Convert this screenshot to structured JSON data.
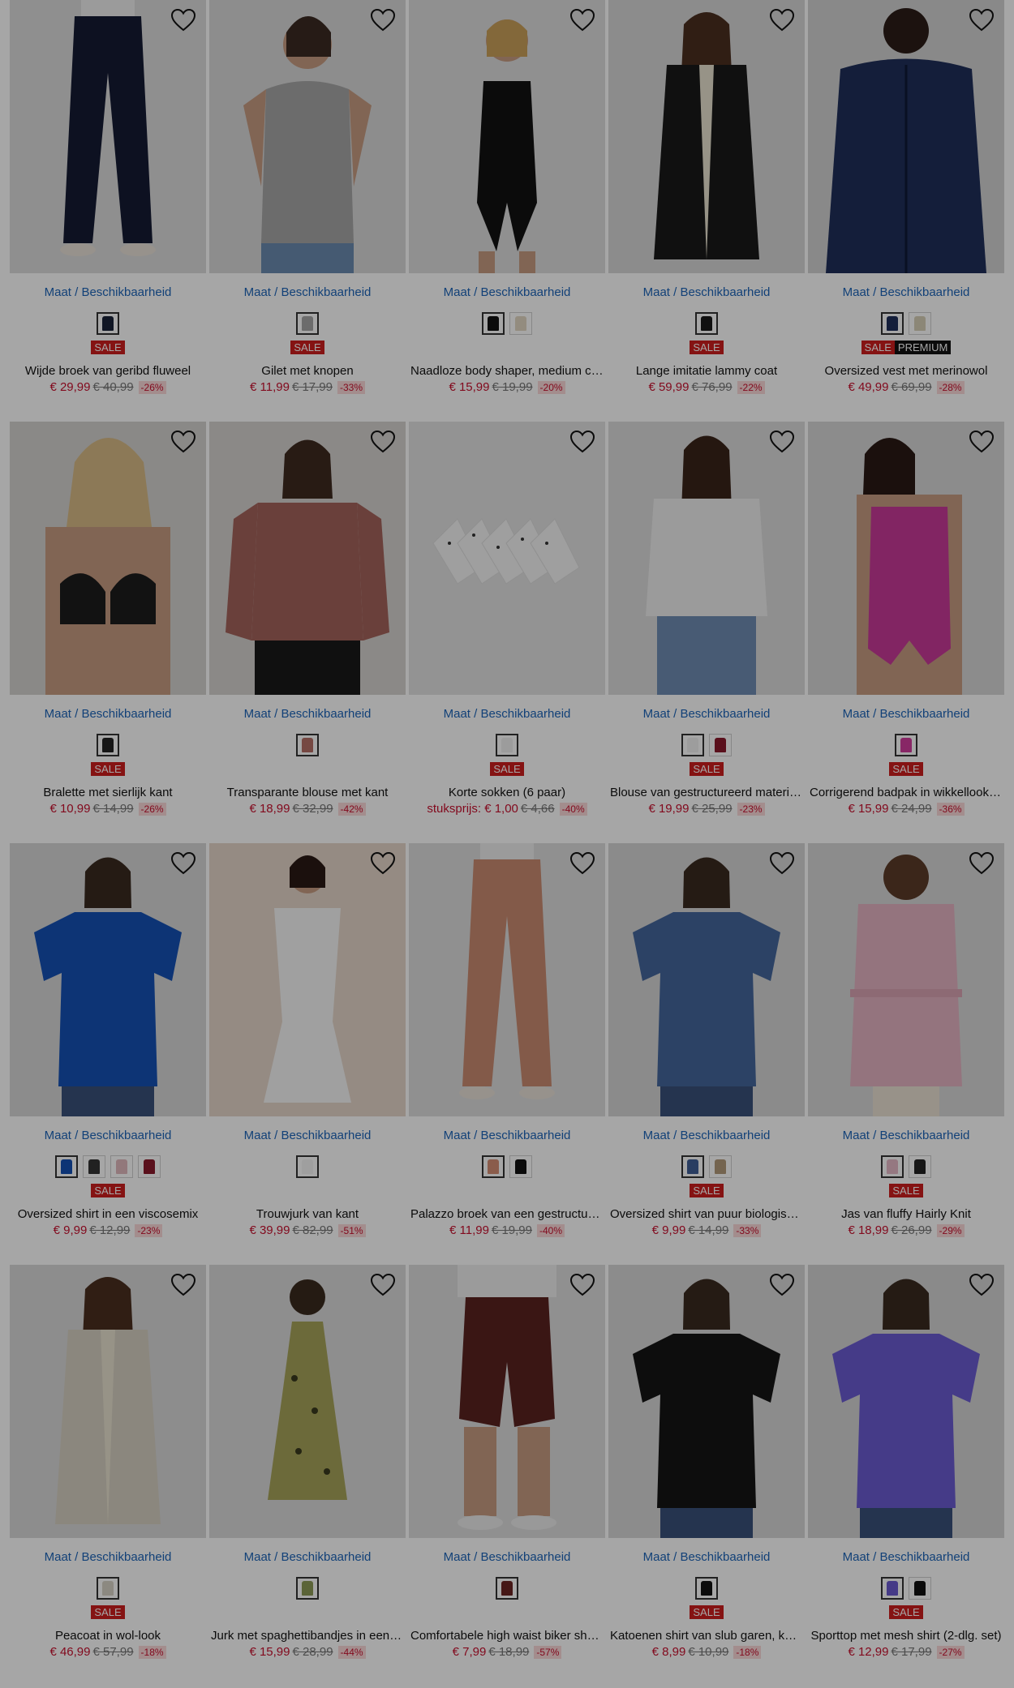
{
  "size_link_label": "Maat / Beschikbaarheid",
  "sale_label": "SALE",
  "premium_label": "PREMIUM",
  "products": [
    {
      "name": "Wijde broek van geribd fluweel",
      "price": "€ 29,99",
      "old_price": "€ 40,99",
      "discount": "-26%",
      "badges": [
        "sale"
      ],
      "swatches": [
        "#1a2238"
      ],
      "bg": "#dcdcdc",
      "garment": "pants",
      "garment_color": "#151b33",
      "icon": "heart-outline-icon"
    },
    {
      "name": "Gilet met knopen",
      "price": "€ 11,99",
      "old_price": "€ 17,99",
      "discount": "-33%",
      "badges": [
        "sale"
      ],
      "swatches": [
        "#a7a7a7"
      ],
      "bg": "#d9d9d9",
      "garment": "vest",
      "garment_color": "#a6a6a6"
    },
    {
      "name": "Naadloze body shaper, medium corrigerend",
      "price": "€ 15,99",
      "old_price": "€ 19,99",
      "discount": "-20%",
      "badges": [],
      "swatches": [
        "#111111",
        "#e2d8c4"
      ],
      "bg": "#dedede",
      "garment": "bodysuit",
      "garment_color": "#111111"
    },
    {
      "name": "Lange imitatie lammy coat",
      "price": "€ 59,99",
      "old_price": "€ 76,99",
      "discount": "-22%",
      "badges": [
        "sale"
      ],
      "swatches": [
        "#1a1a1a"
      ],
      "bg": "#d8d8d8",
      "garment": "coat",
      "garment_color": "#1a1a1a"
    },
    {
      "name": "Oversized vest met merinowol",
      "price": "€ 49,99",
      "old_price": "€ 69,99",
      "discount": "-28%",
      "badges": [
        "sale",
        "premium"
      ],
      "swatches": [
        "#1f2f5a",
        "#d8cfb7"
      ],
      "bg": "#d3d3d3",
      "garment": "jacket",
      "garment_color": "#1f2f5a"
    },
    {
      "name": "Bralette met sierlijk kant",
      "price": "€ 10,99",
      "old_price": "€ 14,99",
      "discount": "-26%",
      "badges": [
        "sale"
      ],
      "swatches": [
        "#222222"
      ],
      "bg": "#d5d3cf",
      "garment": "bra",
      "garment_color": "#1d1d1d"
    },
    {
      "name": "Transparante blouse met kant",
      "price": "€ 18,99",
      "old_price": "€ 32,99",
      "discount": "-42%",
      "badges": [],
      "swatches": [
        "#b56f66"
      ],
      "bg": "#d6d3d0",
      "garment": "blouse",
      "garment_color": "#a4635b"
    },
    {
      "name": "Korte sokken (6 paar)",
      "unit_label": "stuksprijs: € 1,00",
      "old_price": "€ 4,66",
      "discount": "-40%",
      "badges": [
        "sale"
      ],
      "swatches": [
        "#f0f0f0"
      ],
      "bg": "#e2e2e2",
      "garment": "socks",
      "garment_color": "#f4f4f4"
    },
    {
      "name": "Blouse van gestructureerd materiaal",
      "price": "€ 19,99",
      "old_price": "€ 25,99",
      "discount": "-23%",
      "badges": [
        "sale"
      ],
      "swatches": [
        "#f2f2f2",
        "#8b1a2b"
      ],
      "bg": "#dcdcdc",
      "garment": "shirt",
      "garment_color": "#efefef"
    },
    {
      "name": "Corrigerend badpak in wikkellook, shape-effect",
      "price": "€ 15,99",
      "old_price": "€ 24,99",
      "discount": "-36%",
      "badges": [
        "sale"
      ],
      "swatches": [
        "#d13c9d"
      ],
      "bg": "#d8d8d8",
      "garment": "swimsuit",
      "garment_color": "#c83a98"
    },
    {
      "name": "Oversized shirt in een viscosemix",
      "price": "€ 9,99",
      "old_price": "€ 12,99",
      "discount": "-23%",
      "badges": [
        "sale"
      ],
      "swatches": [
        "#1451b4",
        "#333333",
        "#e1b9bd",
        "#8b1a2b"
      ],
      "bg": "#d7d7d7",
      "garment": "tshirt",
      "garment_color": "#1451b4"
    },
    {
      "name": "Trouwjurk van kant",
      "price": "€ 39,99",
      "old_price": "€ 82,99",
      "discount": "-51%",
      "badges": [],
      "swatches": [
        "#f4f4f4"
      ],
      "bg": "#e5d6c9",
      "garment": "gown",
      "garment_color": "#f6f6f6"
    },
    {
      "name": "Palazzo broek van een gestructureerde stof",
      "price": "€ 11,99",
      "old_price": "€ 19,99",
      "discount": "-40%",
      "badges": [],
      "swatches": [
        "#d58e74",
        "#111111"
      ],
      "bg": "#dedede",
      "garment": "pants",
      "garment_color": "#c98a70"
    },
    {
      "name": "Oversized shirt van puur biologisch katoen",
      "price": "€ 9,99",
      "old_price": "€ 14,99",
      "discount": "-33%",
      "badges": [
        "sale"
      ],
      "swatches": [
        "#3f5f95",
        "#b29a7a"
      ],
      "bg": "#d6d6d6",
      "garment": "tshirt",
      "garment_color": "#44669b"
    },
    {
      "name": "Jas van fluffy Hairly Knit",
      "price": "€ 18,99",
      "old_price": "€ 26,99",
      "discount": "-29%",
      "badges": [
        "sale"
      ],
      "swatches": [
        "#e5b9c7",
        "#222222"
      ],
      "bg": "#d8d8d8",
      "garment": "robe",
      "garment_color": "#e3b3c2"
    },
    {
      "name": "Peacoat in wol-look",
      "price": "€ 46,99",
      "old_price": "€ 57,99",
      "discount": "-18%",
      "badges": [
        "sale"
      ],
      "swatches": [
        "#d8d3c6"
      ],
      "bg": "#d9d9d9",
      "garment": "coat",
      "garment_color": "#d6d0c2"
    },
    {
      "name": "Jurk met spaghettibandjes in een zomerse print",
      "price": "€ 15,99",
      "old_price": "€ 28,99",
      "discount": "-44%",
      "badges": [],
      "swatches": [
        "#8d9a56"
      ],
      "bg": "#dadada",
      "garment": "dress",
      "garment_color": "#a6a35a"
    },
    {
      "name": "Comfortabele high waist biker shorts",
      "price": "€ 7,99",
      "old_price": "€ 18,99",
      "discount": "-57%",
      "badges": [],
      "swatches": [
        "#6a2422"
      ],
      "bg": "#dedede",
      "garment": "shorts",
      "garment_color": "#5a2220"
    },
    {
      "name": "Katoenen shirt van slub garen, korte mouw",
      "price": "€ 8,99",
      "old_price": "€ 10,99",
      "discount": "-18%",
      "badges": [
        "sale"
      ],
      "swatches": [
        "#111111"
      ],
      "bg": "#d8d8d8",
      "garment": "tshirt",
      "garment_color": "#141414"
    },
    {
      "name": "Sporttop met mesh shirt (2-dlg. set)",
      "price": "€ 12,99",
      "old_price": "€ 17,99",
      "discount": "-27%",
      "badges": [
        "sale"
      ],
      "swatches": [
        "#6a5ad0",
        "#111111"
      ],
      "bg": "#d5d5d5",
      "garment": "tshirt",
      "garment_color": "#6b5bd2"
    }
  ]
}
